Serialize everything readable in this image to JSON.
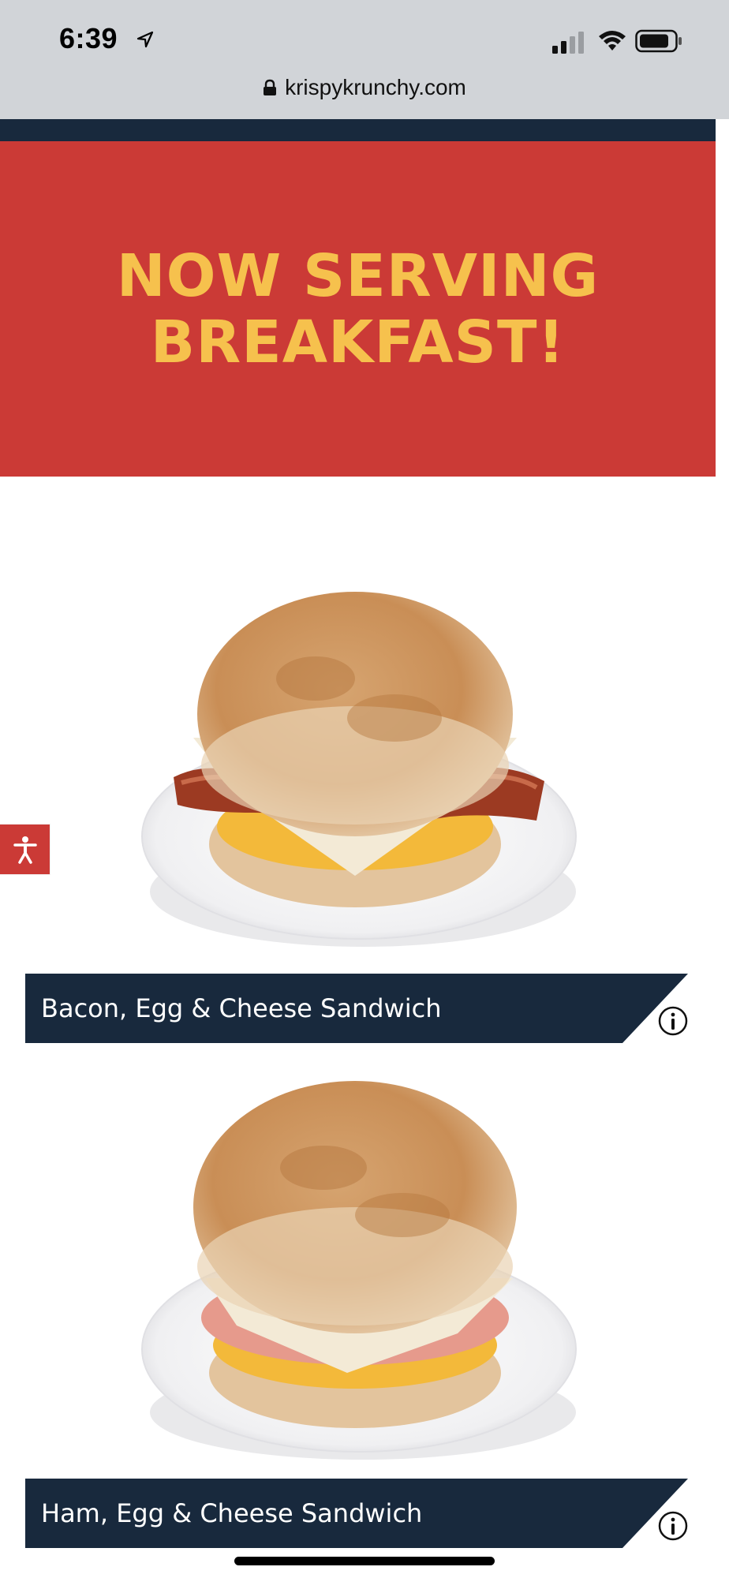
{
  "status_bar": {
    "time": "6:39",
    "icons": [
      "location-arrow-icon",
      "cellular-signal-icon",
      "wifi-icon",
      "battery-icon"
    ]
  },
  "browser": {
    "url": "krispykrunchy.com",
    "lock_icon": "lock-icon"
  },
  "colors": {
    "nav": "#18293d",
    "hero_bg": "#cb3a36",
    "hero_text": "#f6c14d",
    "label_bg": "#18293d"
  },
  "hero": {
    "title": "NOW SERVING BREAKFAST!"
  },
  "accessibility": {
    "icon": "accessibility-icon"
  },
  "menu_items": [
    {
      "name": "Bacon, Egg & Cheese Sandwich",
      "image_icon": "sandwich-image",
      "info_icon": "info-icon"
    },
    {
      "name": "Ham, Egg & Cheese Sandwich",
      "image_icon": "sandwich-image",
      "info_icon": "info-icon"
    }
  ]
}
